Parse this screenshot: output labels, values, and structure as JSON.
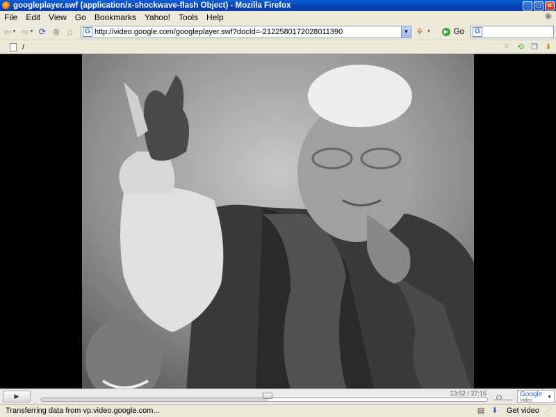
{
  "window": {
    "title": "googleplayer.swf (application/x-shockwave-flash Object) - Mozilla Firefox",
    "minimize_glyph": "_",
    "maximize_glyph": "□",
    "close_glyph": "✕"
  },
  "menu": {
    "items": [
      "File",
      "Edit",
      "View",
      "Go",
      "Bookmarks",
      "Yahoo!",
      "Tools",
      "Help"
    ]
  },
  "toolbar": {
    "url": "http://video.google.com/googleplayer.swf?docId=-2122580172028011390",
    "go_label": "Go",
    "search_value": ""
  },
  "tab": {
    "label": "/"
  },
  "player": {
    "timecode": "13:52 / 27:15",
    "progress": 0.51,
    "logo_text": "Google",
    "logo_sub": "Video"
  },
  "status": {
    "text": "Transferring data from vp.video.google.com...",
    "get_video": "Get video"
  },
  "icons": {
    "back": "back-arrow-icon",
    "forward": "forward-arrow-icon",
    "reload": "reload-icon",
    "stop": "stop-icon",
    "home": "home-icon"
  }
}
